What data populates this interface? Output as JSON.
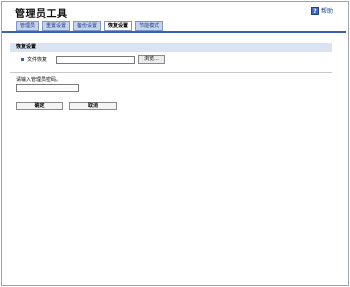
{
  "header": {
    "title": "管理员工具",
    "help_label": "帮助",
    "help_icon": "help-icon"
  },
  "tabs": [
    {
      "label": "管理员",
      "active": false
    },
    {
      "label": "重置设置",
      "active": false
    },
    {
      "label": "备份设置",
      "active": false
    },
    {
      "label": "恢复设置",
      "active": true
    },
    {
      "label": "节能模式",
      "active": false
    }
  ],
  "restore": {
    "section_title": "恢复设置",
    "file_label": "文件恢复",
    "file_value": "",
    "browse_label": "浏览..."
  },
  "password": {
    "prompt": "请输入管理员密码。",
    "value": ""
  },
  "buttons": {
    "ok": "确定",
    "cancel": "取消"
  },
  "colors": {
    "accent": "#3b63b5",
    "tab_bg": "#c6d4ea",
    "section_bg": "#d9e3f2"
  }
}
